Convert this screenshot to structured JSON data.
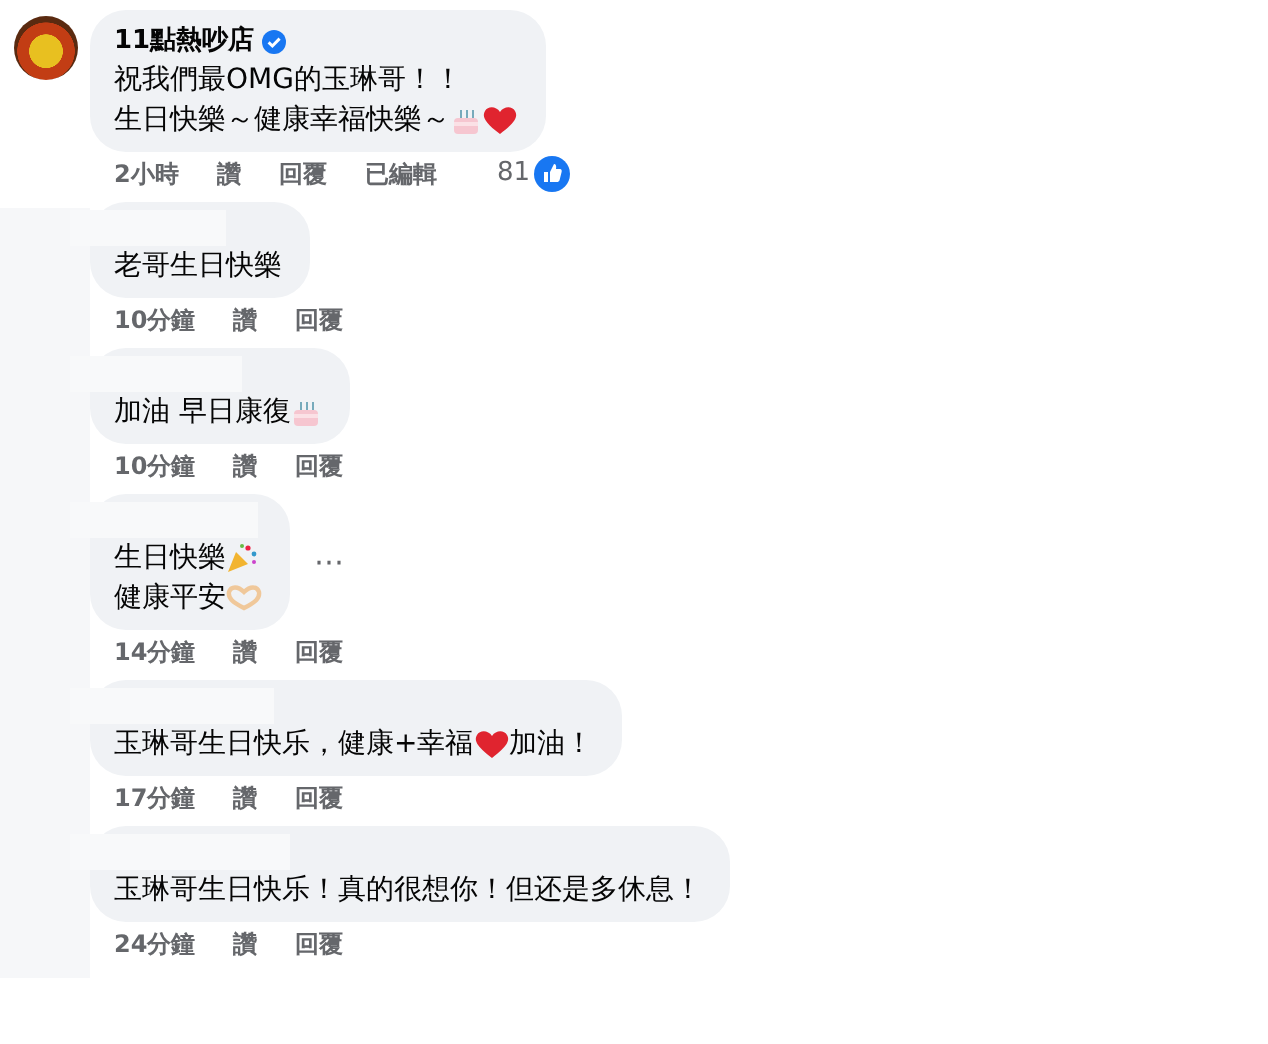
{
  "comments": [
    {
      "author": {
        "name": "11點熱吵店",
        "verified": true,
        "redacted": false
      },
      "lines": [
        [
          {
            "kind": "text",
            "text": "祝我們最OMG的玉琳哥！！"
          }
        ],
        [
          {
            "kind": "text",
            "text": "生日快樂～健康幸福快樂～"
          },
          {
            "kind": "cake"
          },
          {
            "kind": "heart"
          }
        ]
      ],
      "time": "2小時",
      "like": "讚",
      "reply": "回覆",
      "edited": "已編輯",
      "reactions": "81"
    },
    {
      "author": {
        "redacted": true
      },
      "lines": [
        [
          {
            "kind": "text",
            "text": "老哥生日快樂"
          }
        ]
      ],
      "time": "10分鐘",
      "like": "讚",
      "reply": "回覆"
    },
    {
      "author": {
        "redacted": true
      },
      "lines": [
        [
          {
            "kind": "text",
            "text": "加油 早日康復"
          },
          {
            "kind": "cake"
          }
        ]
      ],
      "time": "10分鐘",
      "like": "讚",
      "reply": "回覆"
    },
    {
      "author": {
        "redacted": true
      },
      "lines": [
        [
          {
            "kind": "text",
            "text": "生日快樂"
          },
          {
            "kind": "party"
          }
        ],
        [
          {
            "kind": "text",
            "text": "健康平安"
          },
          {
            "kind": "hands"
          }
        ]
      ],
      "time": "14分鐘",
      "like": "讚",
      "reply": "回覆",
      "more": "⋯"
    },
    {
      "author": {
        "redacted": true
      },
      "lines": [
        [
          {
            "kind": "text",
            "text": "玉琳哥生日快乐，健康+幸福"
          },
          {
            "kind": "heart"
          },
          {
            "kind": "text",
            "text": "加油！"
          }
        ]
      ],
      "time": "17分鐘",
      "like": "讚",
      "reply": "回覆"
    },
    {
      "author": {
        "redacted": true
      },
      "lines": [
        [
          {
            "kind": "text",
            "text": "玉琳哥生日快乐！真的很想你！但还是多休息！"
          }
        ]
      ],
      "time": "24分鐘",
      "like": "讚",
      "reply": "回覆"
    }
  ]
}
